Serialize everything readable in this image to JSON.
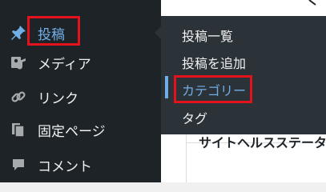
{
  "sidebar": {
    "items": [
      {
        "icon": "pin-icon",
        "label": "投稿"
      },
      {
        "icon": "media-icon",
        "label": "メディア"
      },
      {
        "icon": "link-icon",
        "label": "リンク"
      },
      {
        "icon": "page-icon",
        "label": "固定ページ"
      },
      {
        "icon": "comment-icon",
        "label": "コメント"
      }
    ]
  },
  "flyout": {
    "items": [
      {
        "label": "投稿一覧"
      },
      {
        "label": "投稿を追加"
      },
      {
        "label": "カテゴリー"
      },
      {
        "label": "タグ"
      }
    ]
  },
  "content": {
    "widget_title": "サイトヘルスステータス"
  },
  "colors": {
    "sidebar_bg": "#1d2327",
    "flyout_bg": "#2c3338",
    "accent": "#72aee6",
    "highlight": "#e3121d"
  }
}
